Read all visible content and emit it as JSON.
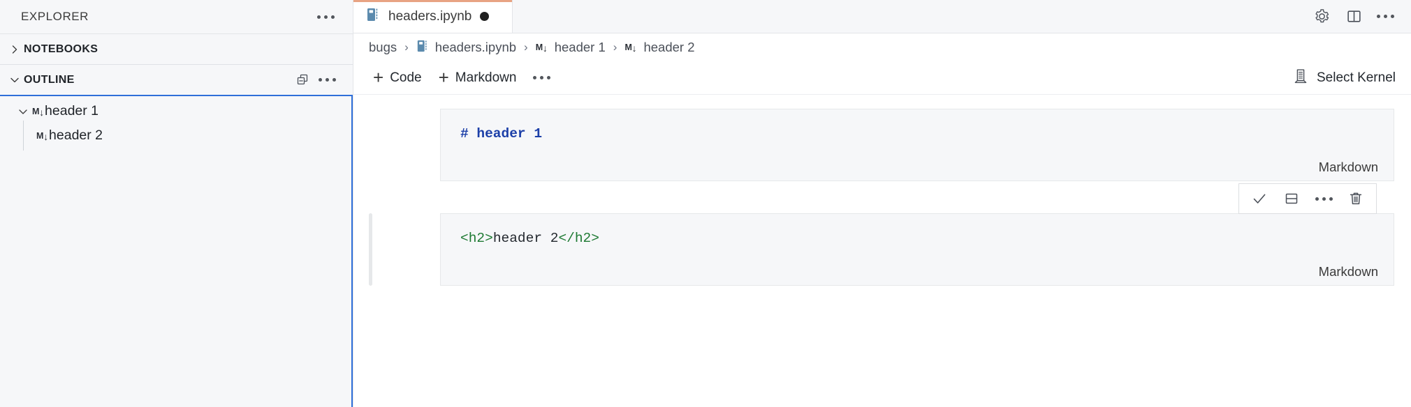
{
  "sidebar": {
    "title": "EXPLORER",
    "more_icon": "ellipsis-icon",
    "sections": [
      {
        "label": "NOTEBOOKS",
        "expanded": false,
        "chevron": "chevron-right-icon"
      },
      {
        "label": "OUTLINE",
        "expanded": true,
        "chevron": "chevron-down-icon",
        "actions": [
          "collapse-all-icon",
          "ellipsis-icon"
        ]
      }
    ],
    "outline": {
      "items": [
        {
          "label": "header 1",
          "badge": "M",
          "badge_arrow": "↓",
          "level": 1,
          "expanded": true,
          "chevron": "chevron-down-icon"
        },
        {
          "label": "header 2",
          "badge": "M",
          "badge_arrow": "↓",
          "level": 2,
          "expanded": false,
          "chevron": ""
        }
      ],
      "focus_border_color": "#2f6fd9"
    }
  },
  "tabbar": {
    "tabs": [
      {
        "label": "headers.ipynb",
        "icon": "notebook-icon",
        "dirty": true,
        "active": true,
        "active_border_color": "#e8a383"
      }
    ],
    "actions": [
      {
        "name": "settings-gear-icon"
      },
      {
        "name": "split-editor-icon"
      },
      {
        "name": "ellipsis-icon"
      }
    ]
  },
  "breadcrumb": {
    "items": [
      {
        "label": "bugs",
        "icon": ""
      },
      {
        "label": "headers.ipynb",
        "icon": "notebook-icon"
      },
      {
        "label": "header 1",
        "icon": "markdown-badge"
      },
      {
        "label": "header 2",
        "icon": "markdown-badge"
      }
    ],
    "separator": "›"
  },
  "notebook_toolbar": {
    "add_code_label": "Code",
    "add_markdown_label": "Markdown",
    "more_icon": "ellipsis-icon",
    "kernel_label": "Select Kernel",
    "kernel_icon": "server-kernel-icon"
  },
  "cells": [
    {
      "kind_label": "Markdown",
      "focused": false,
      "source_tokens": [
        {
          "text": "# header ",
          "type": "md-heading"
        },
        {
          "text": "1",
          "type": "md-heading-highlight"
        }
      ]
    },
    {
      "kind_label": "Markdown",
      "focused": true,
      "source_tokens": [
        {
          "text": "<h2>",
          "type": "tag"
        },
        {
          "text": "header 2",
          "type": "plain"
        },
        {
          "text": "</h2>",
          "type": "tag"
        }
      ],
      "toolbar": [
        {
          "name": "confirm-check-icon"
        },
        {
          "name": "split-cell-icon"
        },
        {
          "name": "more-ellipsis-icon"
        },
        {
          "name": "delete-cell-icon"
        }
      ]
    }
  ],
  "colors": {
    "accent_blue": "#2f6fd9",
    "tab_active_top": "#e8a383",
    "markdown_heading": "#1c3fa8",
    "html_tag_green": "#1e7a33",
    "panel_bg": "#f6f7f9"
  }
}
